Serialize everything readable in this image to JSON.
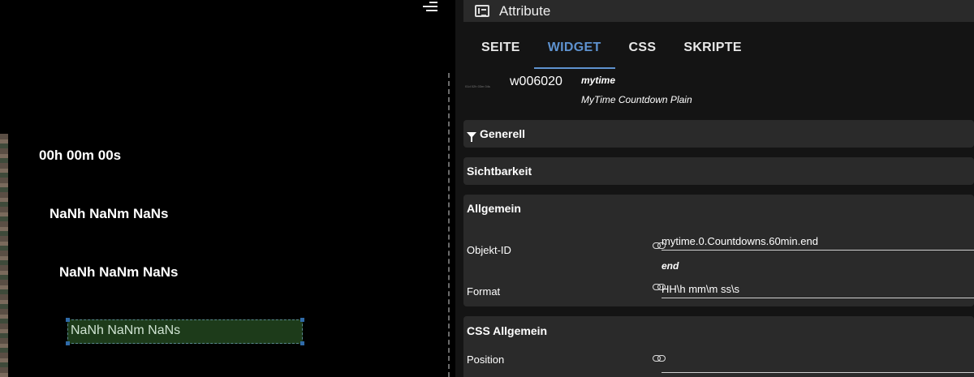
{
  "canvas": {
    "countdowns": [
      "00h 00m 00s",
      "NaNh NaNm NaNs",
      "NaNh NaNm NaNs",
      "NaNh NaNm NaNs"
    ]
  },
  "panel": {
    "header": {
      "title": "Attribute",
      "icon": "list-icon"
    },
    "tabs": [
      {
        "label": "SEITE",
        "active": false
      },
      {
        "label": "WIDGET",
        "active": true
      },
      {
        "label": "CSS",
        "active": false
      },
      {
        "label": "SKRIPTE",
        "active": false
      }
    ],
    "widget": {
      "thumb_text": "01d 02h 03m 04s",
      "id": "w006020",
      "set": "mytime",
      "name": "MyTime Countdown Plain"
    },
    "sections": {
      "generell": "Generell",
      "sichtbarkeit": "Sichtbarkeit",
      "allgemein": {
        "title": "Allgemein",
        "objekt_id_label": "Objekt-ID",
        "objekt_id_value": "mytime.0.Countdowns.60min.end",
        "objekt_id_sub": "end",
        "format_label": "Format",
        "format_value": "HH\\h mm\\m ss\\s"
      },
      "css_allgemein": {
        "title": "CSS Allgemein",
        "position_label": "Position",
        "position_value": ""
      }
    }
  },
  "colors": {
    "accent": "#5e92cf",
    "panel_bg": "#141414",
    "section_bg": "#2a2a2a",
    "selected_widget_bg": "#1d3b1a"
  }
}
